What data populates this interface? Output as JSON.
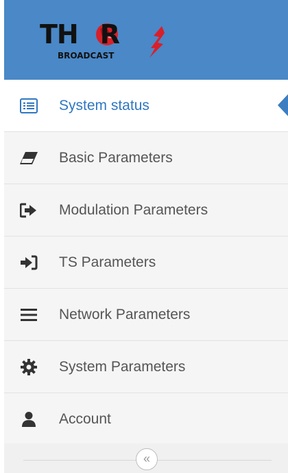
{
  "brand": {
    "logo_text": "THOR",
    "logo_sub": "BROADCAST",
    "header_color": "#4a88c7",
    "accent_red": "#d8202a"
  },
  "menu": {
    "items": [
      {
        "label": "System status",
        "icon": "list-icon",
        "active": true
      },
      {
        "label": "Basic Parameters",
        "icon": "eraser-icon",
        "active": false
      },
      {
        "label": "Modulation Parameters",
        "icon": "sign-out-icon",
        "active": false
      },
      {
        "label": "TS Parameters",
        "icon": "sign-in-icon",
        "active": false
      },
      {
        "label": "Network Parameters",
        "icon": "bars-icon",
        "active": false
      },
      {
        "label": "System Parameters",
        "icon": "gear-icon",
        "active": false
      },
      {
        "label": "Account",
        "icon": "user-icon",
        "active": false
      }
    ],
    "active_color": "#2f77c1"
  },
  "collapse": {
    "glyph": "«"
  }
}
